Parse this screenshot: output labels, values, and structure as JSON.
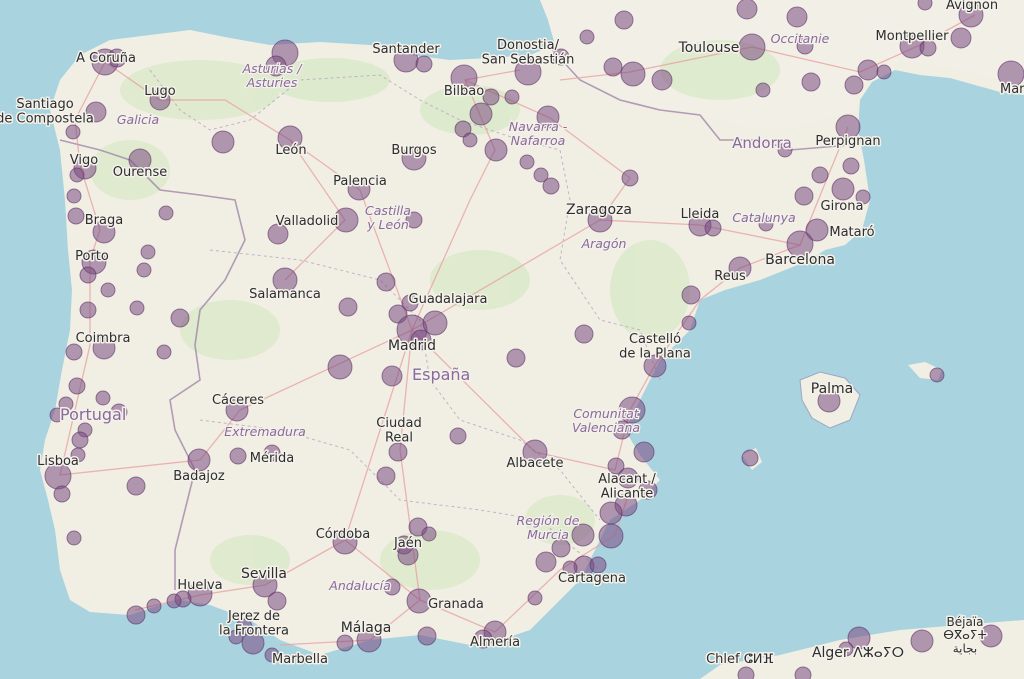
{
  "map": {
    "cities": [
      {
        "id": "a-coruna",
        "name": "A Coruña"
      },
      {
        "id": "lugo",
        "name": "Lugo"
      },
      {
        "id": "santiago",
        "name": "Santiago\nde Compostela"
      },
      {
        "id": "vigo",
        "name": "Vigo"
      },
      {
        "id": "ourense",
        "name": "Ourense"
      },
      {
        "id": "braga",
        "name": "Braga"
      },
      {
        "id": "porto",
        "name": "Porto"
      },
      {
        "id": "coimbra",
        "name": "Coimbra"
      },
      {
        "id": "lisboa",
        "name": "Lisboa"
      },
      {
        "id": "leon",
        "name": "León"
      },
      {
        "id": "santander",
        "name": "Santander"
      },
      {
        "id": "donostia",
        "name": "Donostia/\nSan Sebastián"
      },
      {
        "id": "bilbao",
        "name": "Bilbao"
      },
      {
        "id": "burgos",
        "name": "Burgos"
      },
      {
        "id": "palencia",
        "name": "Palencia"
      },
      {
        "id": "valladolid",
        "name": "Valladolid"
      },
      {
        "id": "salamanca",
        "name": "Salamanca"
      },
      {
        "id": "guadalajara",
        "name": "Guadalajara"
      },
      {
        "id": "madrid",
        "name": "Madrid"
      },
      {
        "id": "caceres",
        "name": "Cáceres"
      },
      {
        "id": "badajoz",
        "name": "Badajoz"
      },
      {
        "id": "merida",
        "name": "Mérida"
      },
      {
        "id": "ciudad-real",
        "name": "Ciudad\nReal"
      },
      {
        "id": "albacete",
        "name": "Albacete"
      },
      {
        "id": "zaragoza",
        "name": "Zaragoza"
      },
      {
        "id": "toulouse",
        "name": "Toulouse"
      },
      {
        "id": "montpellier",
        "name": "Montpellier"
      },
      {
        "id": "avignon",
        "name": "Avignon"
      },
      {
        "id": "marseille",
        "name": "Marse"
      },
      {
        "id": "perpignan",
        "name": "Perpignan"
      },
      {
        "id": "andorra",
        "name": "Andorra"
      },
      {
        "id": "lleida",
        "name": "Lleida"
      },
      {
        "id": "girona",
        "name": "Girona"
      },
      {
        "id": "mataro",
        "name": "Mataró"
      },
      {
        "id": "barcelona",
        "name": "Barcelona"
      },
      {
        "id": "reus",
        "name": "Reus"
      },
      {
        "id": "castello",
        "name": "Castelló\nde la Plana"
      },
      {
        "id": "palma",
        "name": "Palma"
      },
      {
        "id": "alacant",
        "name": "Alacant /\nAlicante"
      },
      {
        "id": "cartagena",
        "name": "Cartagena"
      },
      {
        "id": "jaen",
        "name": "Jaén"
      },
      {
        "id": "cordoba",
        "name": "Córdoba"
      },
      {
        "id": "sevilla",
        "name": "Sevilla"
      },
      {
        "id": "huelva",
        "name": "Huelva"
      },
      {
        "id": "jerez",
        "name": "Jerez de\nla Frontera"
      },
      {
        "id": "granada",
        "name": "Granada"
      },
      {
        "id": "malaga",
        "name": "Málaga"
      },
      {
        "id": "almeria",
        "name": "Almería"
      },
      {
        "id": "marbella",
        "name": "Marbella"
      },
      {
        "id": "alger",
        "name": "Alger ⴷⵣⴰⵢⵔ"
      },
      {
        "id": "chlef",
        "name": "Chlef ⵛⵍⴼ"
      },
      {
        "id": "bejaia",
        "name": "Béjaïa\nⴱⴳⴰⵢⵜ\nبجاية"
      }
    ],
    "regions": [
      {
        "id": "asturias",
        "name": "Asturias /\nAsturies"
      },
      {
        "id": "galicia",
        "name": "Galicia"
      },
      {
        "id": "navarra",
        "name": "Navarra -\nNafarroa"
      },
      {
        "id": "castilla",
        "name": "Castilla\ny León"
      },
      {
        "id": "aragon",
        "name": "Aragón"
      },
      {
        "id": "catalunya",
        "name": "Catalunya"
      },
      {
        "id": "occitanie",
        "name": "Occitanie"
      },
      {
        "id": "extremadura",
        "name": "Extremadura"
      },
      {
        "id": "comunitat",
        "name": "Comunitat\nValenciana"
      },
      {
        "id": "murcia",
        "name": "Región de\nMurcia"
      },
      {
        "id": "andalucia",
        "name": "Andalucía"
      }
    ],
    "countries": [
      {
        "id": "espana",
        "name": "España"
      },
      {
        "id": "portugal",
        "name": "Portugal"
      }
    ],
    "colors": {
      "sea": "#a9d3df",
      "land": "#f3f1ea",
      "marker": "#7a4a82",
      "road": "#e8a3a3",
      "border": "#9b7fa6"
    }
  }
}
